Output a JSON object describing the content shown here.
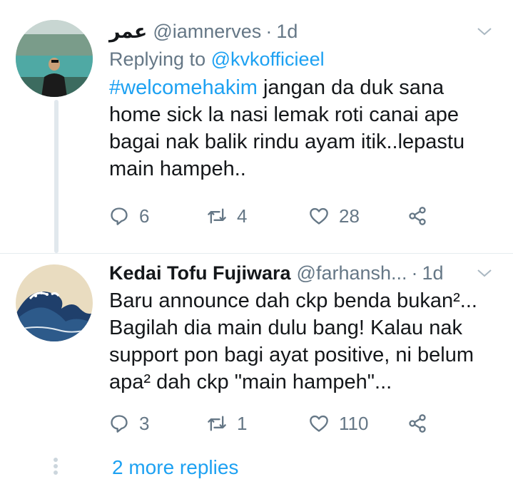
{
  "tweets": [
    {
      "name": "عمر",
      "handle": "@iamnerves",
      "time": "1d",
      "replying_prefix": "Replying to",
      "replying_handle": "@kvkofficieel",
      "hashtag": "#welcomehakim",
      "text": " jangan da duk sana home sick la nasi lemak roti canai ape bagai nak balik rindu ayam itik..lepastu main hampeh..",
      "replies": "6",
      "retweets": "4",
      "likes": "28"
    },
    {
      "name": "Kedai Tofu Fujiwara",
      "handle": "@farhansh...",
      "time": "1d",
      "text": "Baru announce dah ckp benda bukan²... Bagilah dia main dulu bang! Kalau nak support pon bagi ayat positive, ni belum apa² dah ckp \"main hampeh\"...",
      "replies": "3",
      "retweets": "1",
      "likes": "110"
    }
  ],
  "more_replies": "2 more replies",
  "colors": {
    "accent": "#1da1f2",
    "secondary": "#657786",
    "text": "#14171a"
  }
}
